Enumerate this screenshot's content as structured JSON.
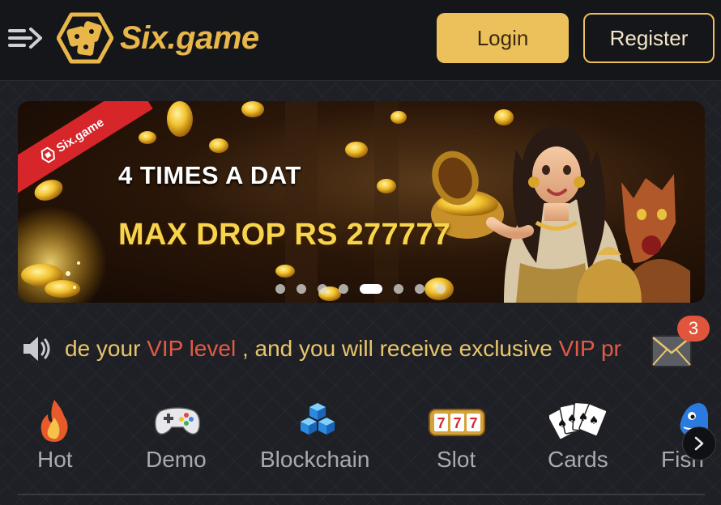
{
  "header": {
    "menu_icon": "menu-arrow-icon",
    "logo_text": "Six.game",
    "login_label": "Login",
    "register_label": "Register"
  },
  "banner": {
    "ribbon_text": "Six.game",
    "line1": "4 TIMES A DAT",
    "line2": "MAX DROP RS 277777",
    "slide_count": 8,
    "active_slide": 5
  },
  "notice": {
    "speaker_icon": "speaker-icon",
    "text_part1": "de your ",
    "text_highlight1": "VIP level",
    "text_part2": " , and you will receive exclusive ",
    "text_highlight2": "VIP pr",
    "mail_icon": "mail-icon",
    "mail_badge": "3"
  },
  "categories": [
    {
      "label": "Hot",
      "icon": "flame-icon"
    },
    {
      "label": "Demo",
      "icon": "gamepad-icon"
    },
    {
      "label": "Blockchain",
      "icon": "blocks-icon"
    },
    {
      "label": "Slot",
      "icon": "slot-machine-icon"
    },
    {
      "label": "Cards",
      "icon": "playing-cards-icon"
    },
    {
      "label": "Fish",
      "icon": "fish-icon"
    }
  ],
  "colors": {
    "accent_gold": "#ecc05b",
    "highlight_red": "#e25b45",
    "marquee_gold": "#e8c66a",
    "background": "#1e1f25"
  }
}
